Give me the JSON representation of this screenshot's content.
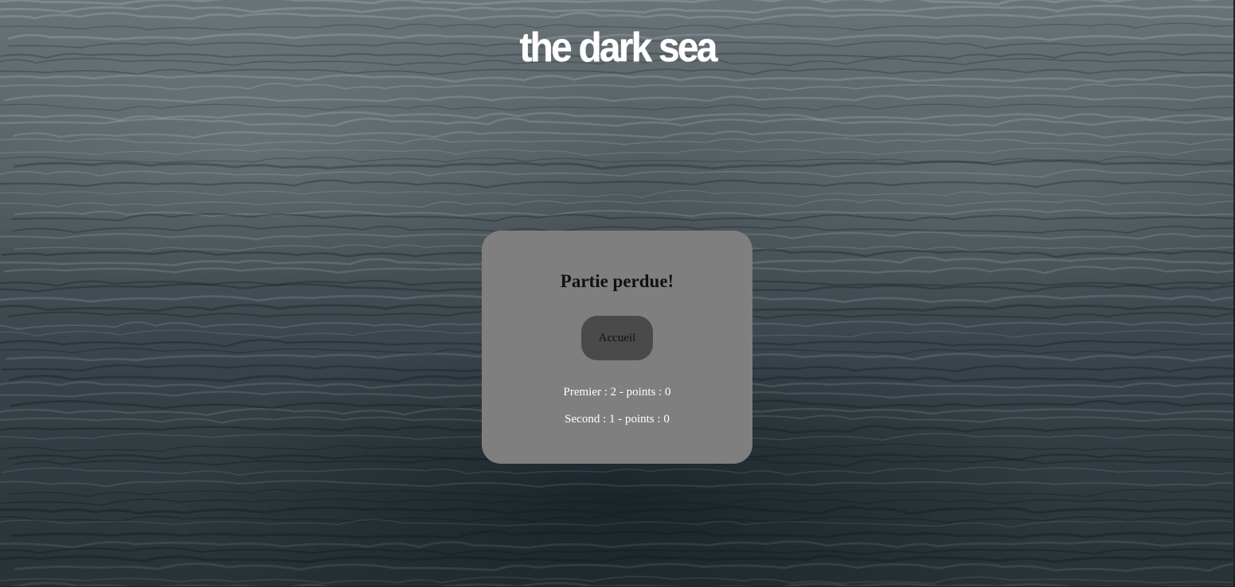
{
  "page": {
    "title": "the dark sea",
    "background": "dark ocean waves",
    "colors": {
      "title": "#ffffff",
      "panel": "#7f7f7f",
      "button": "#4a4a4a",
      "score_text": "#ffffff"
    }
  },
  "dialog": {
    "heading": "Partie perdue!",
    "home_button_label": "Accueil",
    "scores": [
      {
        "label": "Premier : 2 - points : 0"
      },
      {
        "label": "Second : 1 - points : 0"
      }
    ]
  }
}
